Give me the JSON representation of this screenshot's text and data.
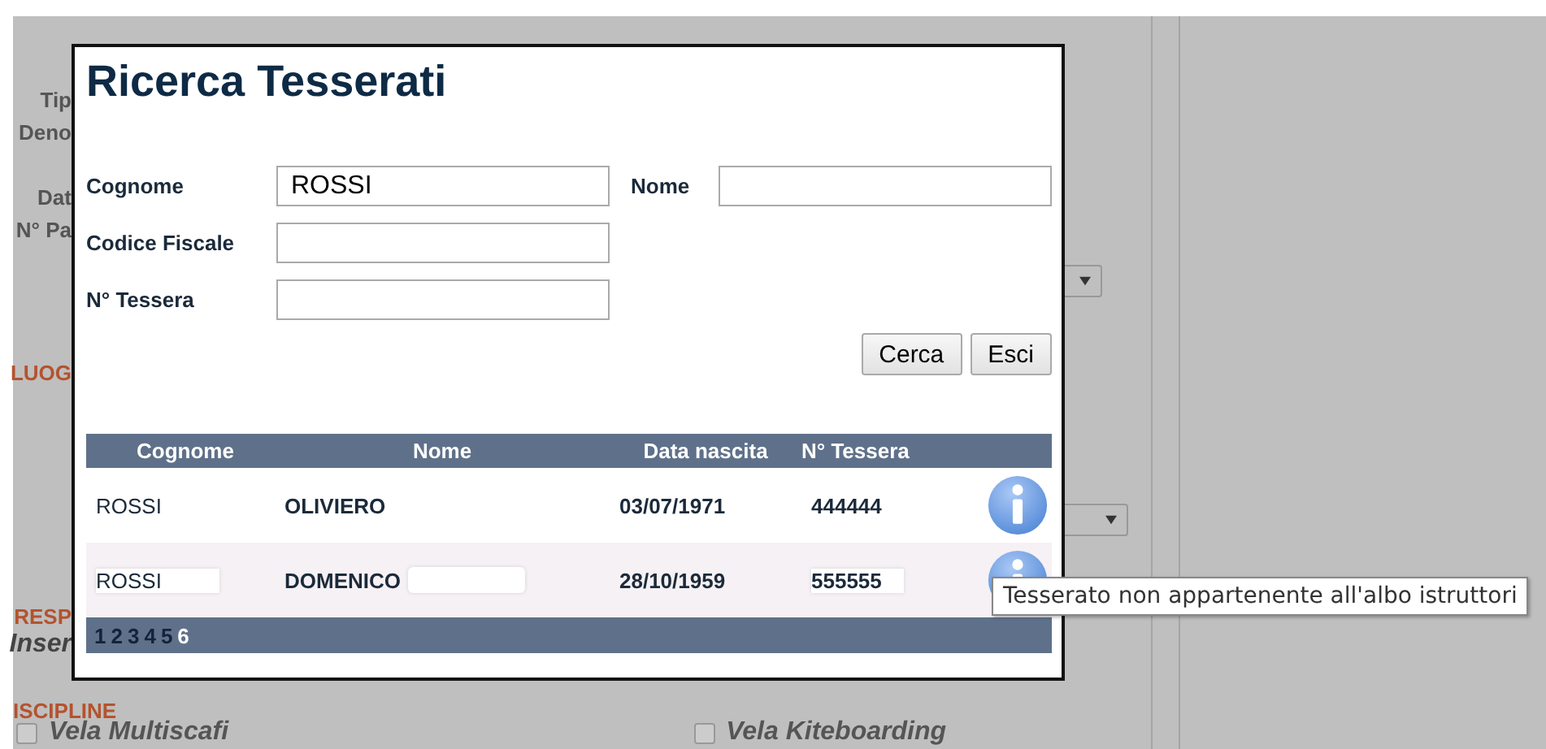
{
  "background_form": {
    "labels": [
      {
        "text": "Tip",
        "kind": "field"
      },
      {
        "text": "Deno",
        "kind": "field"
      },
      {
        "text": "Dat",
        "kind": "field"
      },
      {
        "text": "N° Pa",
        "kind": "field"
      },
      {
        "text": "LUOG",
        "kind": "section"
      },
      {
        "text": "RESP",
        "kind": "section"
      },
      {
        "text": "Inser",
        "kind": "note"
      },
      {
        "text": "ISCIPLINE",
        "kind": "heading"
      }
    ],
    "disciplines": [
      {
        "label": "Vela Multiscafi",
        "checked": false
      },
      {
        "label": "Vela Kiteboarding",
        "checked": false
      }
    ]
  },
  "dialog": {
    "title": "Ricerca Tesserati",
    "fields": [
      {
        "label": "Cognome",
        "value": "ROSSI"
      },
      {
        "label": "Nome"
      },
      {
        "label": "Codice Fiscale"
      },
      {
        "label": "N° Tessera"
      }
    ],
    "buttons": [
      "Cerca",
      "Esci"
    ],
    "table": {
      "columns": [
        "Cognome",
        "Nome",
        "Data nascita",
        "N° Tessera"
      ],
      "rows": [
        {
          "cells": [
            "ROSSI",
            "OLIVIERO",
            "03/07/1971",
            "444444"
          ],
          "redacted": false
        },
        {
          "cells": [
            "ROSSI",
            "DOMENICO",
            "28/10/1959",
            "555555"
          ],
          "redacted": true
        }
      ]
    },
    "pages": [
      {
        "label": "1",
        "selected": false
      },
      {
        "label": "2",
        "selected": false
      },
      {
        "label": "3",
        "selected": false
      },
      {
        "label": "4",
        "selected": false
      },
      {
        "label": "5",
        "selected": false
      },
      {
        "label": "6",
        "selected": true
      }
    ]
  },
  "tooltip": {
    "text": "Tesserato non appartenente all'albo istruttori"
  }
}
